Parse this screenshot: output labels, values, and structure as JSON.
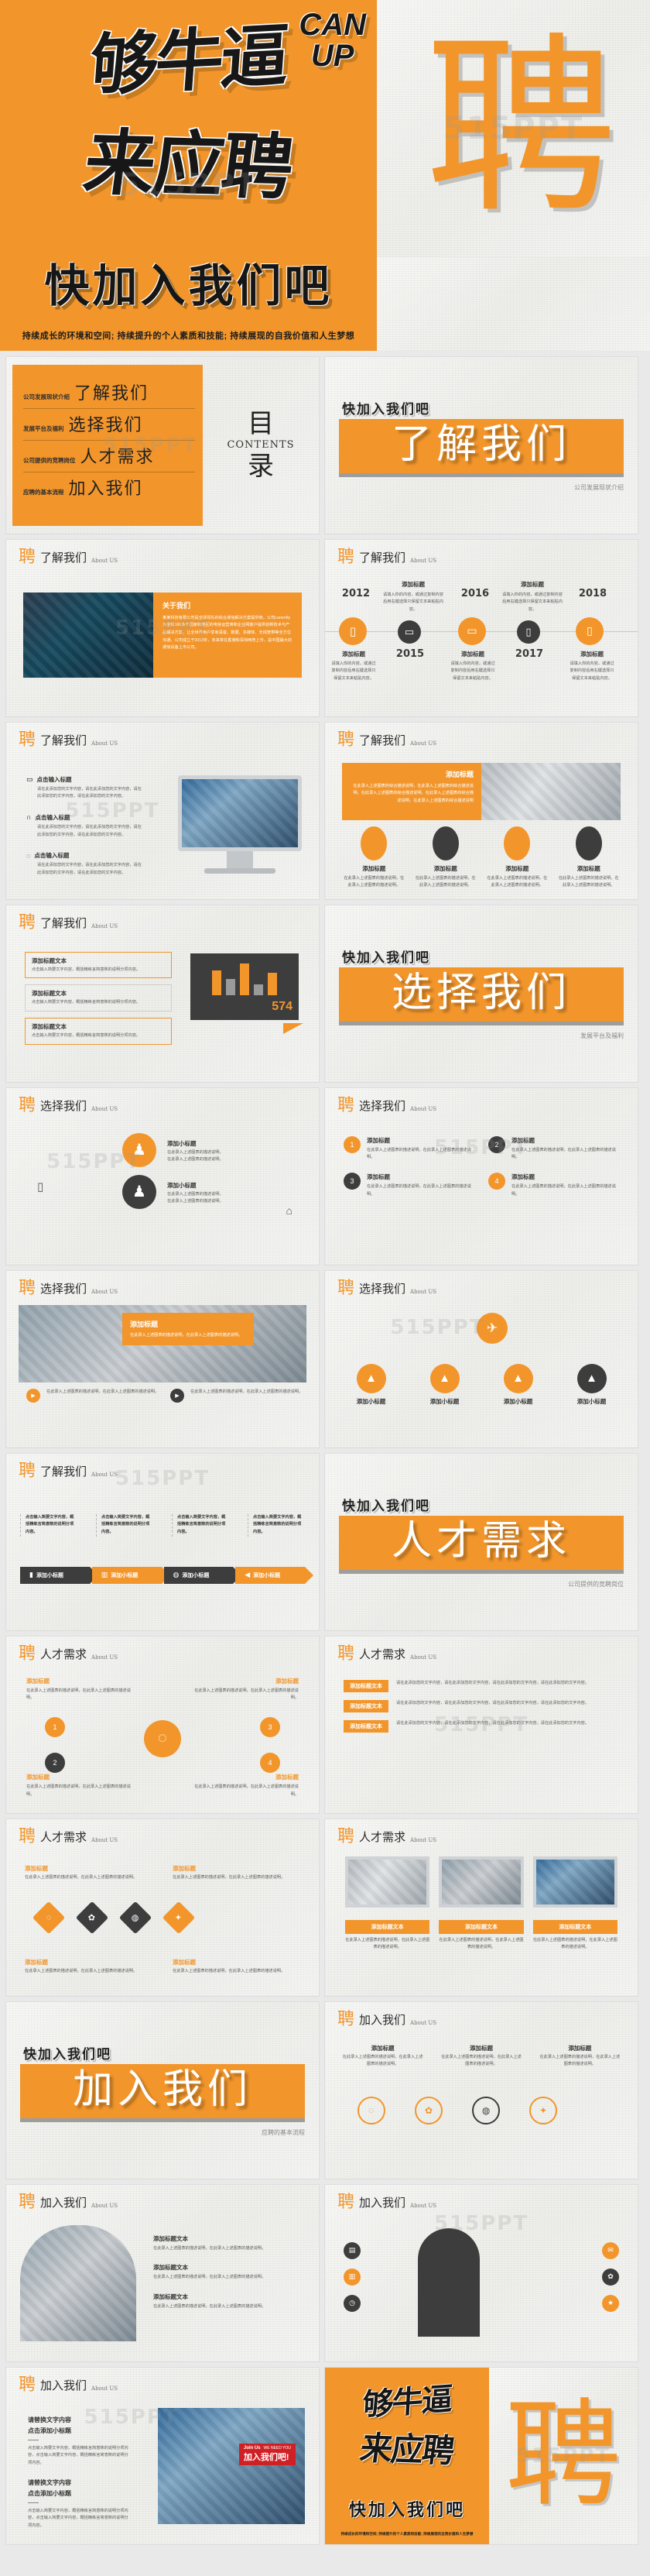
{
  "brand": {
    "accent": "#f2962c",
    "dark": "#3d3d3d",
    "paper": "#f2f2f0",
    "watermark": "515PPT"
  },
  "cover": {
    "graffiti_line1": "够牛逼",
    "graffiti_line2": "来应聘",
    "graffiti_en_1": "CAN",
    "graffiti_en_2": "UP",
    "pin_glyph": "聘",
    "headline": "快加入我们吧",
    "tagline": "持续成长的环境和空间;    持续提升的个人素质和技能;    持续展现的自我价值和人生梦想"
  },
  "toc": {
    "title_cn_1": "目",
    "title_en": "CONTENTS",
    "title_cn_2": "录",
    "items": [
      {
        "caption": "公司发展现状介绍",
        "label": "了解我们"
      },
      {
        "caption": "发展平台及福利",
        "label": "选择我们"
      },
      {
        "caption": "公司提供的竞聘岗位",
        "label": "人才需求"
      },
      {
        "caption": "应聘的基本流程",
        "label": "加入我们"
      }
    ]
  },
  "dividers": [
    {
      "small": "快加入我们吧",
      "big": "了解我们",
      "sub": "公司发展现状介绍"
    },
    {
      "small": "快加入我们吧",
      "big": "选择我们",
      "sub": "发展平台及福利"
    },
    {
      "small": "快加入我们吧",
      "big": "人才需求",
      "sub": "公司提供的竞聘岗位"
    },
    {
      "small": "快加入我们吧",
      "big": "加入我们",
      "sub": "应聘的基本流程"
    }
  ],
  "headers": {
    "about": {
      "logo": "聘",
      "zh": "了解我们",
      "en": "About US"
    },
    "choose": {
      "logo": "聘",
      "zh": "选择我们",
      "en": "About US"
    },
    "talent": {
      "logo": "聘",
      "zh": "人才需求",
      "en": "About US"
    },
    "join": {
      "logo": "聘",
      "zh": "加入我们",
      "en": "About US"
    }
  },
  "common": {
    "add_title": "添加标题",
    "add_subtitle": "添加小标题",
    "click_title": "点击输入标题",
    "replace_text": "请替换文字内容",
    "click_add_sub": "点击添加小标题",
    "lorem_short": "请填入你的内容，或通过复制内容后用右键选择只保留文本来粘贴内容。",
    "lorem_mid": "请在此添加您的文字内容，请在此添加您的文字内容，请在此添加您的文字内容，请在此添加您的文字内容。",
    "lorem_long": "在此录入上述图表的综合描述说明，在此录入上述图表的综合描述说明，在此录入上述图表的综合描述说明，在此录入上述图表的综合描述说明，在此录入上述图表的综合描述说明",
    "lorem_cell": "在此录入上述图表的描述说明，在此录入上述图表的描述说明。",
    "lorem_bullet": "点击输入简要文字内容，概括精练言简意赅的说明分项内容。",
    "lorem_join": "点击输入简要文字内容，概括精练言简意赅的说明分项内容，点击输入简要文字内容，概括精练言简意赅的说明分项内容。",
    "placeholder_text": "添加标题文本"
  },
  "about_slide": {
    "title": "关于我们",
    "body": "某某科技有限公司是全球领先的综合通信解决方案提供商。公司currently为全球160多个国家和地区的电信运营商和企业网客户提供创新技术与产品解决方案，让全世界用户享有语音、数据、多媒体、无线宽带等全方位沟通。公司成立于2013年，未来将在香港和深圳两地上市，是中国最大的通信设备上市公司。"
  },
  "timeline": {
    "years": [
      "2012",
      "2015",
      "2016",
      "2017",
      "2018"
    ],
    "title": "添加标题",
    "body": "请填入你的内容，或通过复制内容后用右键选择只保留文本来粘贴内容。"
  },
  "bullets3": [
    {
      "icon": "monitor-icon",
      "title": "点击输入标题"
    },
    {
      "icon": "headphone-icon",
      "title": "点击输入标题"
    },
    {
      "icon": "bulb-icon",
      "title": "点击输入标题"
    }
  ],
  "numbers4": [
    "1",
    "2",
    "3",
    "4"
  ],
  "chart_slide": {
    "value_label": "574",
    "bars": [
      70,
      45,
      88,
      30,
      62
    ]
  },
  "process_icons": [
    "briefcase-icon",
    "chart-icon",
    "mouse-icon",
    "speaker-icon"
  ],
  "diamond_icons": [
    "bulb-icon",
    "gear-icon",
    "globe-icon",
    "puzzle-icon"
  ],
  "cap_icons": [
    "cap-icon",
    "cap-icon",
    "cap-icon",
    "cap-icon"
  ],
  "join_final": {
    "line1": "请替换文字内容",
    "line2": "点击添加小标题",
    "badge_en": "Join Us",
    "badge_en2": "WE NEED YOU",
    "badge_cn": "加入我们吧!"
  },
  "end_cover": {
    "graffiti_line1": "够牛逼",
    "graffiti_line2": "来应聘",
    "headline": "快加入我们吧",
    "tagline": "持续成长的环境和空间;   持续提升的个人素质和技能;   持续展现的自我价值和人生梦想",
    "pin_glyph": "聘"
  }
}
